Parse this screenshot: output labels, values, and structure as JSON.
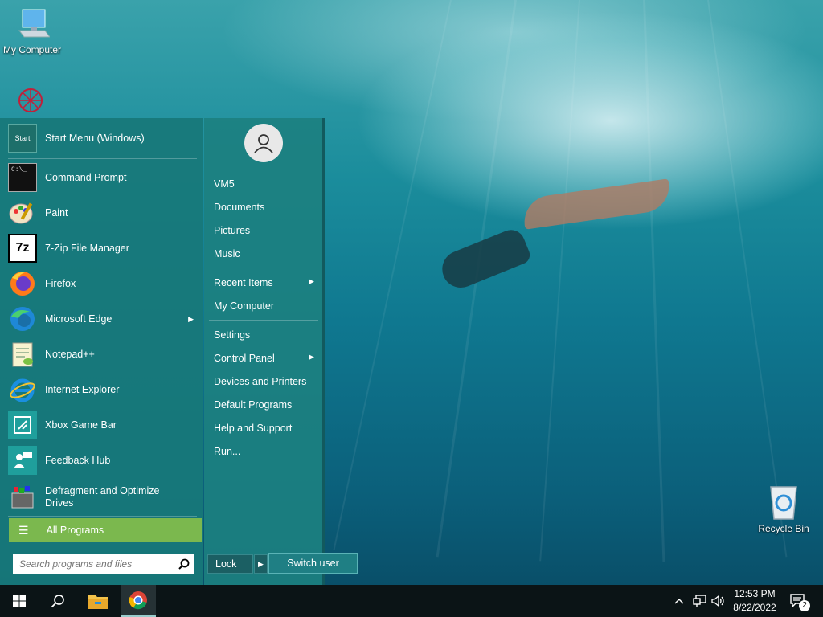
{
  "desktop": {
    "icons": {
      "my_computer": "My Computer",
      "recycle_bin": "Recycle Bin"
    }
  },
  "start_menu": {
    "programs": [
      {
        "label": "Start Menu (Windows)",
        "icon": "start-menu-icon"
      },
      {
        "label": "Command Prompt",
        "icon": "command-prompt-icon"
      },
      {
        "label": "Paint",
        "icon": "paint-icon"
      },
      {
        "label": "7-Zip File Manager",
        "icon": "7zip-icon"
      },
      {
        "label": "Firefox",
        "icon": "firefox-icon"
      },
      {
        "label": "Microsoft Edge",
        "icon": "edge-icon",
        "submenu": true
      },
      {
        "label": "Notepad++",
        "icon": "notepadpp-icon"
      },
      {
        "label": "Internet Explorer",
        "icon": "internet-explorer-icon"
      },
      {
        "label": "Xbox Game Bar",
        "icon": "xbox-game-bar-icon"
      },
      {
        "label": "Feedback Hub",
        "icon": "feedback-hub-icon"
      },
      {
        "label": "Defragment and Optimize Drives",
        "icon": "defrag-icon"
      }
    ],
    "start_icon_text": "Start",
    "cmd_icon_text": "C:\\_",
    "zip_icon_text": "7z",
    "all_programs": "All Programs",
    "search_placeholder": "Search programs and files",
    "right_items": [
      {
        "label": "VM5"
      },
      {
        "label": "Documents"
      },
      {
        "label": "Pictures"
      },
      {
        "label": "Music"
      },
      {
        "label": "Recent Items",
        "submenu": true
      },
      {
        "label": "My Computer"
      },
      {
        "label": "Settings"
      },
      {
        "label": "Control Panel",
        "submenu": true
      },
      {
        "label": "Devices and Printers"
      },
      {
        "label": "Default Programs"
      },
      {
        "label": "Help and Support"
      },
      {
        "label": "Run..."
      }
    ],
    "lock": "Lock",
    "switch_user": "Switch user"
  },
  "taskbar": {
    "time": "12:53 PM",
    "date": "8/22/2022",
    "notifications_count": "2",
    "pinned": [
      "file-explorer-icon",
      "chrome-icon"
    ]
  },
  "colors": {
    "all_programs_bg": "#7bb84e",
    "menu_bg": "#18787a",
    "taskbar_bg": "#0b1416"
  }
}
